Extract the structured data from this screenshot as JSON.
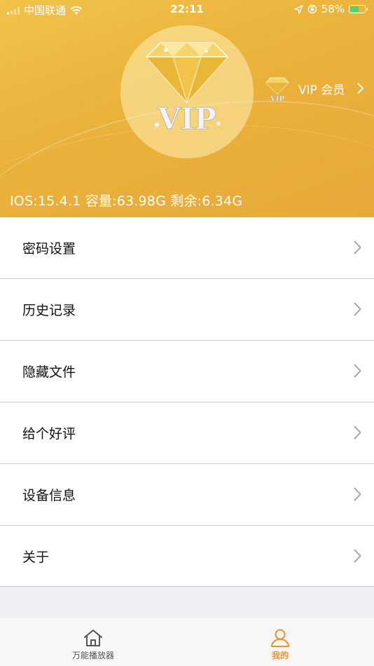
{
  "status_bar": {
    "carrier": "中国联通",
    "time": "22:11",
    "battery_percent": "58%",
    "battery_level": 0.58
  },
  "header": {
    "vip_badge_text": "VIP",
    "vip_link_label": "VIP 会员",
    "device_info": "IOS:15.4.1 容量:63.98G 剩余:6.34G"
  },
  "menu": {
    "items": [
      {
        "label": "密码设置"
      },
      {
        "label": "历史记录"
      },
      {
        "label": "隐藏文件"
      },
      {
        "label": "给个好评"
      },
      {
        "label": "设备信息"
      },
      {
        "label": "关于"
      }
    ]
  },
  "tabbar": {
    "tabs": [
      {
        "label": "万能播放器",
        "active": false
      },
      {
        "label": "我的",
        "active": true
      }
    ],
    "active_color": "#f0902a",
    "inactive_color": "#555555"
  },
  "colors": {
    "header_gold": "#eab23a",
    "diamond": "#f3c84a"
  }
}
